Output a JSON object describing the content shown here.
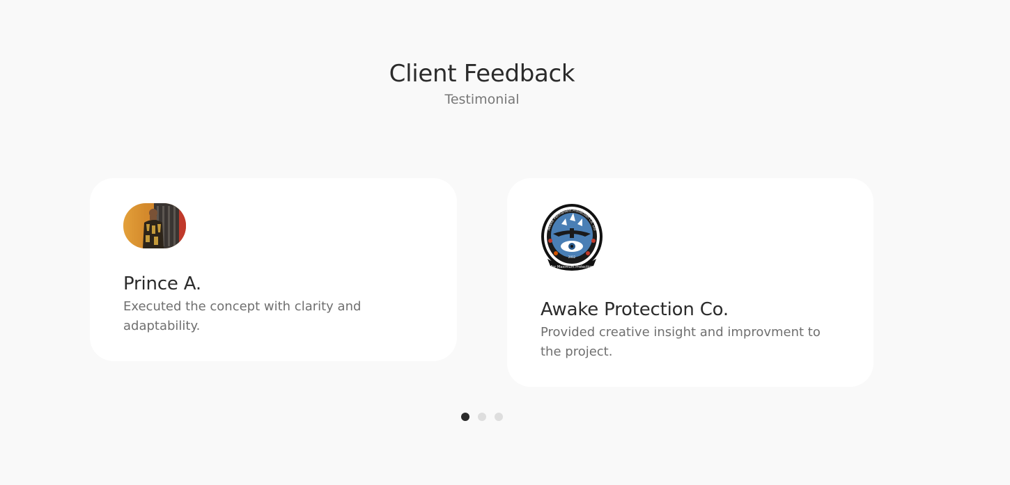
{
  "header": {
    "title": "Client Feedback",
    "subtitle": "Testimonial"
  },
  "testimonials": [
    {
      "name": "Prince A.",
      "quote": "Executed the concept with clarity and adaptability.",
      "avatar": "person-photo"
    },
    {
      "name": "Awake Protection Co.",
      "quote": "Provided creative insight and improvment to the project.",
      "avatar": "company-logo",
      "logo_text": {
        "ring": "Awake Permanent Protection Co. Ltd",
        "motto": "For Maximum Protection",
        "year": "2012"
      }
    }
  ],
  "pager": {
    "count": 3,
    "active_index": 0
  },
  "colors": {
    "background": "#f9f9f9",
    "card": "#ffffff",
    "dot_active": "#2b2b2b",
    "dot_inactive": "#dedede"
  }
}
